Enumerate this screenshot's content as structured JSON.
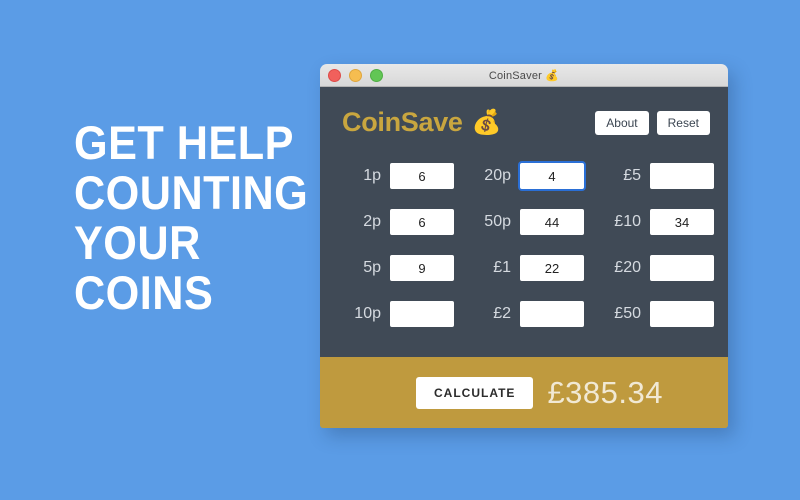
{
  "background": {
    "color": "#5b9ce6"
  },
  "marketing": {
    "lines": [
      "GET HELP",
      "COUNTING",
      "YOUR",
      "COINS"
    ]
  },
  "window": {
    "title": "CoinSaver 💰",
    "traffic_lights": {
      "close": "close-button",
      "minimize": "minimize-button",
      "maximize": "maximize-button"
    },
    "header": {
      "brand_text": "CoinSave",
      "brand_emoji": "💰",
      "brand_color": "#c9a63f",
      "about_label": "About",
      "reset_label": "Reset"
    },
    "coins": [
      {
        "label": "1p",
        "value": "6",
        "focused": false
      },
      {
        "label": "20p",
        "value": "4",
        "focused": true
      },
      {
        "label": "£5",
        "value": "",
        "focused": false
      },
      {
        "label": "2p",
        "value": "6",
        "focused": false
      },
      {
        "label": "50p",
        "value": "44",
        "focused": false
      },
      {
        "label": "£10",
        "value": "34",
        "focused": false
      },
      {
        "label": "5p",
        "value": "9",
        "focused": false
      },
      {
        "label": "£1",
        "value": "22",
        "focused": false
      },
      {
        "label": "£20",
        "value": "",
        "focused": false
      },
      {
        "label": "10p",
        "value": "",
        "focused": false
      },
      {
        "label": "£2",
        "value": "",
        "focused": false
      },
      {
        "label": "£50",
        "value": "",
        "focused": false
      }
    ],
    "footer": {
      "calculate_label": "CALCULATE",
      "total": "£385.34",
      "background_color": "#bf9a3e"
    },
    "body_color": "#404a56"
  }
}
